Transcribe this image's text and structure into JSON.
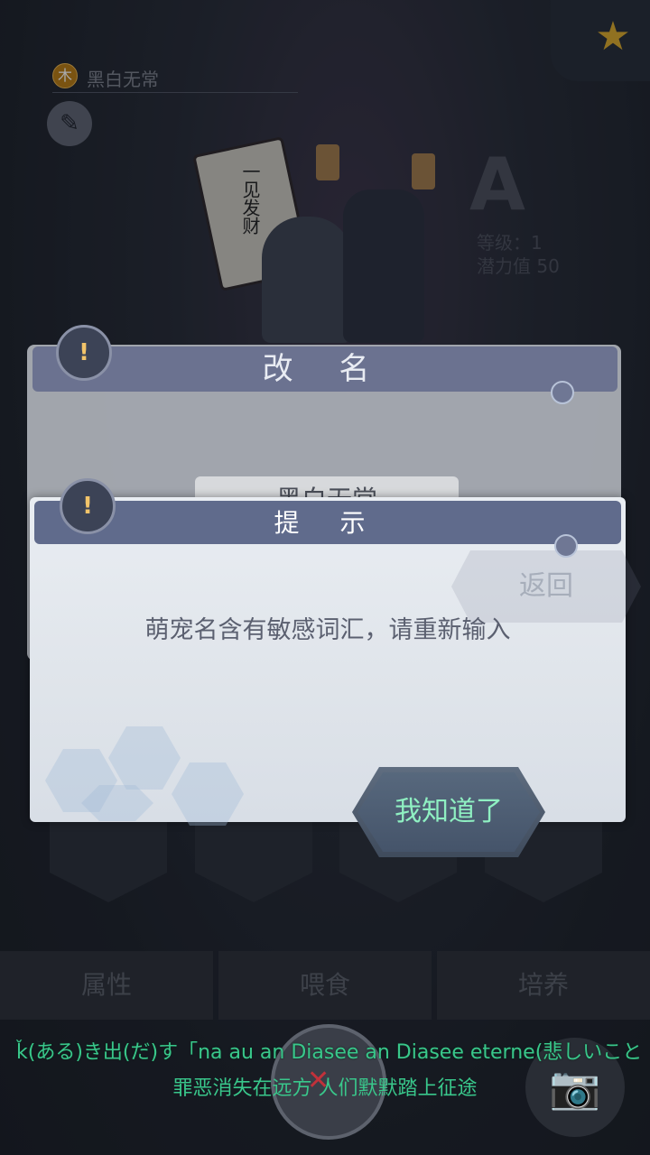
{
  "background": {
    "pet_name": "黑白无常",
    "element_badge": "木",
    "grade": "A",
    "level_label": "等级：1",
    "potential_label": "潜力值  50",
    "banner_text": "一见发财"
  },
  "rename_dialog": {
    "title": "改 名",
    "name_value": "黑白无常"
  },
  "tip_dialog": {
    "title": "提 示",
    "message": "萌宠名含有敏感词汇，请重新输入",
    "ok_label": "我知道了",
    "behind_button_label": "返回"
  },
  "tabs": [
    "属性",
    "喂食",
    "培养"
  ],
  "subtitles": {
    "line1": "ǩ(ある)き出(だ)す「na au an Diasee an Diasee eterne(悲しいこと",
    "line2": "罪恶消失在远方 人们默默踏上征途"
  },
  "icons": {
    "star": "star-icon",
    "pencil": "pencil-icon",
    "camera": "camera-icon",
    "warning": "warning-icon"
  }
}
